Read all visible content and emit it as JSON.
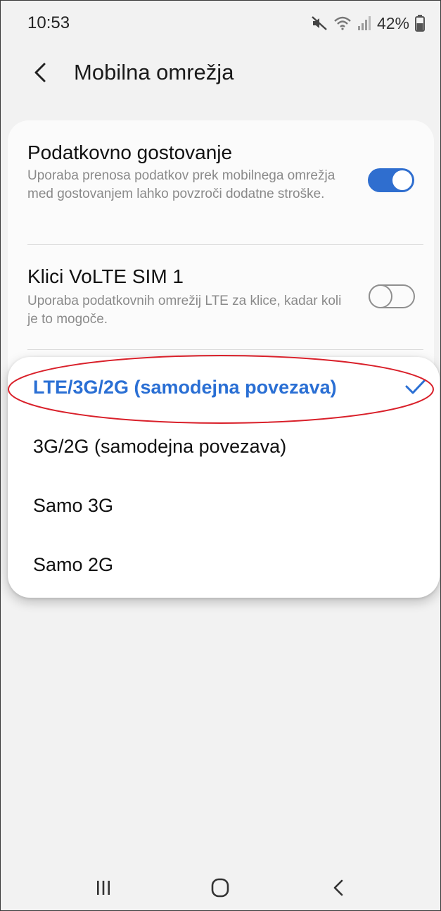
{
  "status_bar": {
    "time": "10:53",
    "battery": "42%",
    "icons": [
      "mute-icon",
      "wifi-icon",
      "signal-icon",
      "battery-icon"
    ]
  },
  "header": {
    "title": "Mobilna omrežja",
    "back_icon": "chevron-left-icon"
  },
  "settings": [
    {
      "title": "Podatkovno gostovanje",
      "description": "Uporaba prenosa podatkov prek mobilnega omrežja med gostovanjem lahko povzroči dodatne stroške.",
      "enabled": true
    },
    {
      "title": "Klici VoLTE SIM 1",
      "description": "Uporaba podatkovnih omrežij LTE za klice, kadar koli je to mogoče.",
      "enabled": false
    }
  ],
  "network_mode_dropdown": {
    "options": [
      "LTE/3G/2G (samodejna povezava)",
      "3G/2G (samodejna povezava)",
      "Samo 3G",
      "Samo 2G"
    ],
    "selected_index": 0
  },
  "nav_bar": {
    "buttons": [
      "recent-apps-icon",
      "home-icon",
      "back-icon"
    ]
  },
  "colors": {
    "accent": "#2a6fd4",
    "annotation": "#d9202a",
    "background": "#f2f2f2"
  }
}
